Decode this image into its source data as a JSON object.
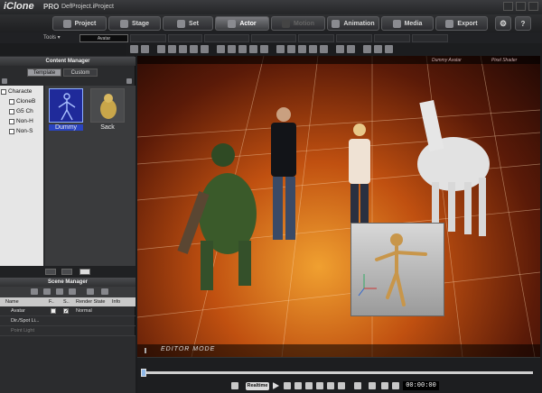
{
  "app": {
    "logo": "iClone",
    "edition": "PRO",
    "project": "DefProject.iProject"
  },
  "tabs": [
    {
      "label": "Project",
      "icon": "project-icon"
    },
    {
      "label": "Stage",
      "icon": "stage-icon"
    },
    {
      "label": "Set",
      "icon": "set-icon"
    },
    {
      "label": "Actor",
      "icon": "actor-icon",
      "active": true
    },
    {
      "label": "Motion",
      "icon": "motion-icon",
      "disabled": true
    },
    {
      "label": "Animation",
      "icon": "animation-icon"
    },
    {
      "label": "Media",
      "icon": "media-icon"
    },
    {
      "label": "Export",
      "icon": "export-icon"
    }
  ],
  "subbar": {
    "tools_label": "Tools ▾",
    "active_item": "Avatar"
  },
  "content_manager": {
    "title": "Content Manager",
    "tabs": [
      "Template",
      "Custom"
    ],
    "tree": [
      "Characte",
      "CloneB",
      "G5 Ch",
      "Non-H",
      "Non-S"
    ],
    "thumbs": [
      {
        "label": "Dummy",
        "selected": true
      },
      {
        "label": "Sack",
        "selected": false
      }
    ]
  },
  "scene_manager": {
    "title": "Scene Manager",
    "columns": [
      "Name",
      "F..",
      "S..",
      "Render State",
      "Info"
    ],
    "rows": [
      {
        "name": "Avatar",
        "render": "Normal"
      },
      {
        "name": "Dir./Spot Li...",
        "render": ""
      },
      {
        "name": "Point Light",
        "render": ""
      }
    ]
  },
  "viewport": {
    "label_left": "Dummy Avatar",
    "label_right": "Pixel Shader",
    "mode_text": "EDITOR MODE"
  },
  "timeline": {
    "realtime_label": "Realtime",
    "timecode": "00:00:00"
  }
}
